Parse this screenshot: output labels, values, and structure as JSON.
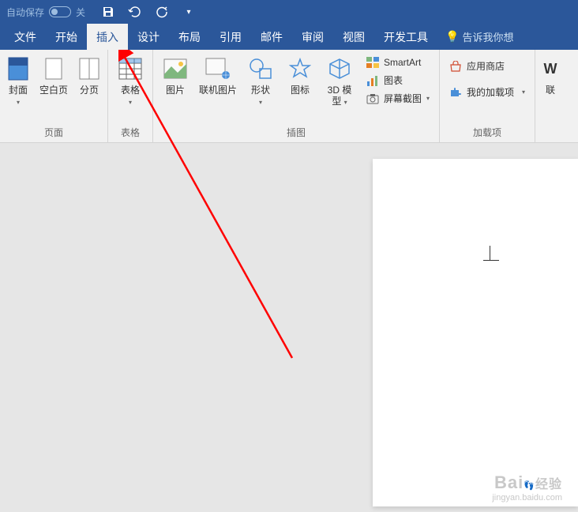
{
  "titlebar": {
    "autosave_label": "自动保存",
    "autosave_state": "关"
  },
  "tabs": {
    "file": "文件",
    "home": "开始",
    "insert": "插入",
    "design": "设计",
    "layout": "布局",
    "references": "引用",
    "mailings": "邮件",
    "review": "审阅",
    "view": "视图",
    "developer": "开发工具",
    "tellme": "告诉我你想"
  },
  "ribbon": {
    "pages": {
      "cover": "封面",
      "blank": "空白页",
      "break": "分页",
      "label": "页面"
    },
    "tables": {
      "table": "表格",
      "label": "表格"
    },
    "illustrations": {
      "picture": "图片",
      "online_picture": "联机图片",
      "shapes": "形状",
      "icons": "图标",
      "model3d_l1": "3D 模",
      "model3d_l2": "型",
      "smartart": "SmartArt",
      "chart": "图表",
      "screenshot": "屏幕截图",
      "label": "插图"
    },
    "addins": {
      "store": "应用商店",
      "myaddins": "我的加载项",
      "wiki": "联",
      "label": "加载项"
    }
  },
  "watermark": {
    "logo": "Bai",
    "logo2": "经验",
    "url": "jingyan.baidu.com"
  }
}
